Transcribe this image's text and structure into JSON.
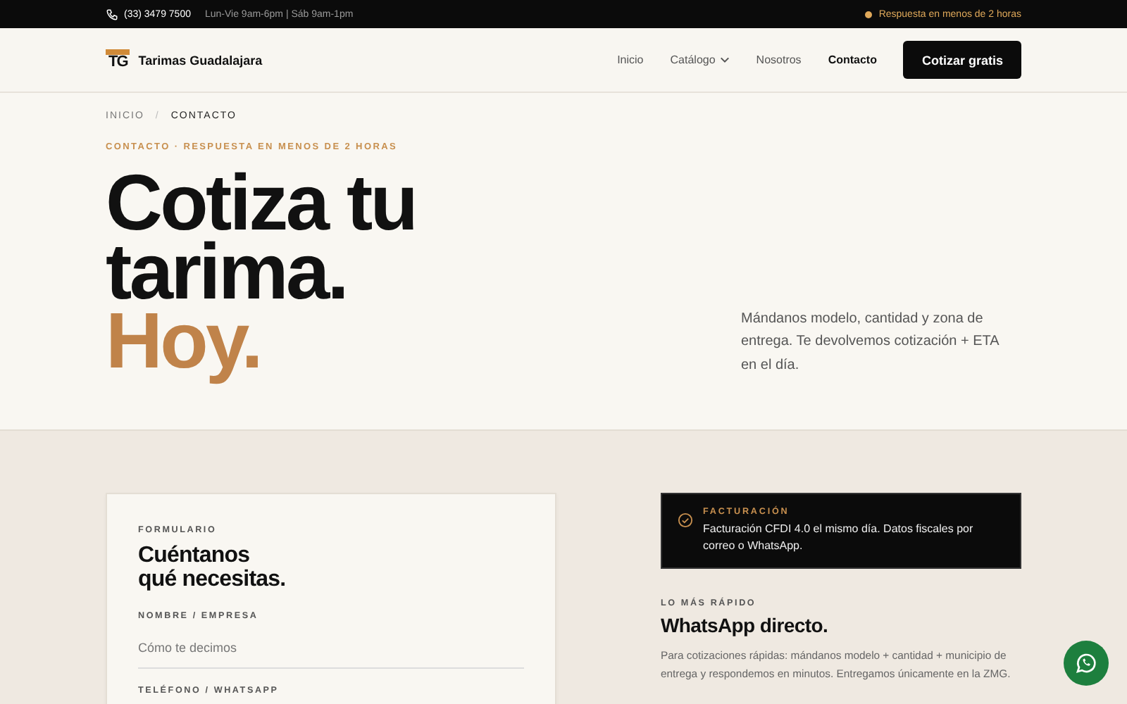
{
  "top_bar": {
    "phone": "(33) 3479 7500",
    "hours": "Lun-Vie 9am-6pm | Sáb 9am-1pm",
    "notice": "Respuesta en menos de 2 horas"
  },
  "header": {
    "logo_mark": "TG",
    "brand": "Tarimas Guadalajara",
    "nav": [
      {
        "label": "Inicio",
        "selected": false,
        "dropdown": false
      },
      {
        "label": "Catálogo",
        "selected": false,
        "dropdown": true
      },
      {
        "label": "Nosotros",
        "selected": false,
        "dropdown": false
      },
      {
        "label": "Contacto",
        "selected": true,
        "dropdown": false
      }
    ],
    "cta": "Cotizar gratis"
  },
  "breadcrumb": [
    {
      "label": "INICIO",
      "selected": false
    },
    {
      "label": "CONTACTO",
      "selected": true
    }
  ],
  "breadcrumb_separator": "/",
  "hero": {
    "eyebrow": "CONTACTO · RESPUESTA EN MENOS DE 2 HORAS",
    "title_lines": [
      "Cotiza tu",
      "tarima."
    ],
    "title_accent": "Hoy.",
    "intro": "Mándanos modelo, cantidad y zona de entrega. Te devolvemos cotización + ETA en el día."
  },
  "form": {
    "eyebrow": "FORMULARIO",
    "title_lines": [
      "Cuéntanos",
      "qué necesitas."
    ],
    "fields": [
      {
        "label": "NOMBRE / EMPRESA",
        "placeholder": "Cómo te decimos"
      },
      {
        "label": "TELÉFONO / WHATSAPP"
      }
    ]
  },
  "billing": {
    "title": "FACTURACIÓN",
    "text": "Facturación CFDI 4.0 el mismo día. Datos fiscales por correo o WhatsApp."
  },
  "whatsapp": {
    "eyebrow": "LO MÁS RÁPIDO",
    "title": "WhatsApp directo.",
    "text": "Para cotizaciones rápidas: mándanos modelo + cantidad + municipio de entrega y respondemos en minutos. Entregamos únicamente en la ZMG."
  }
}
